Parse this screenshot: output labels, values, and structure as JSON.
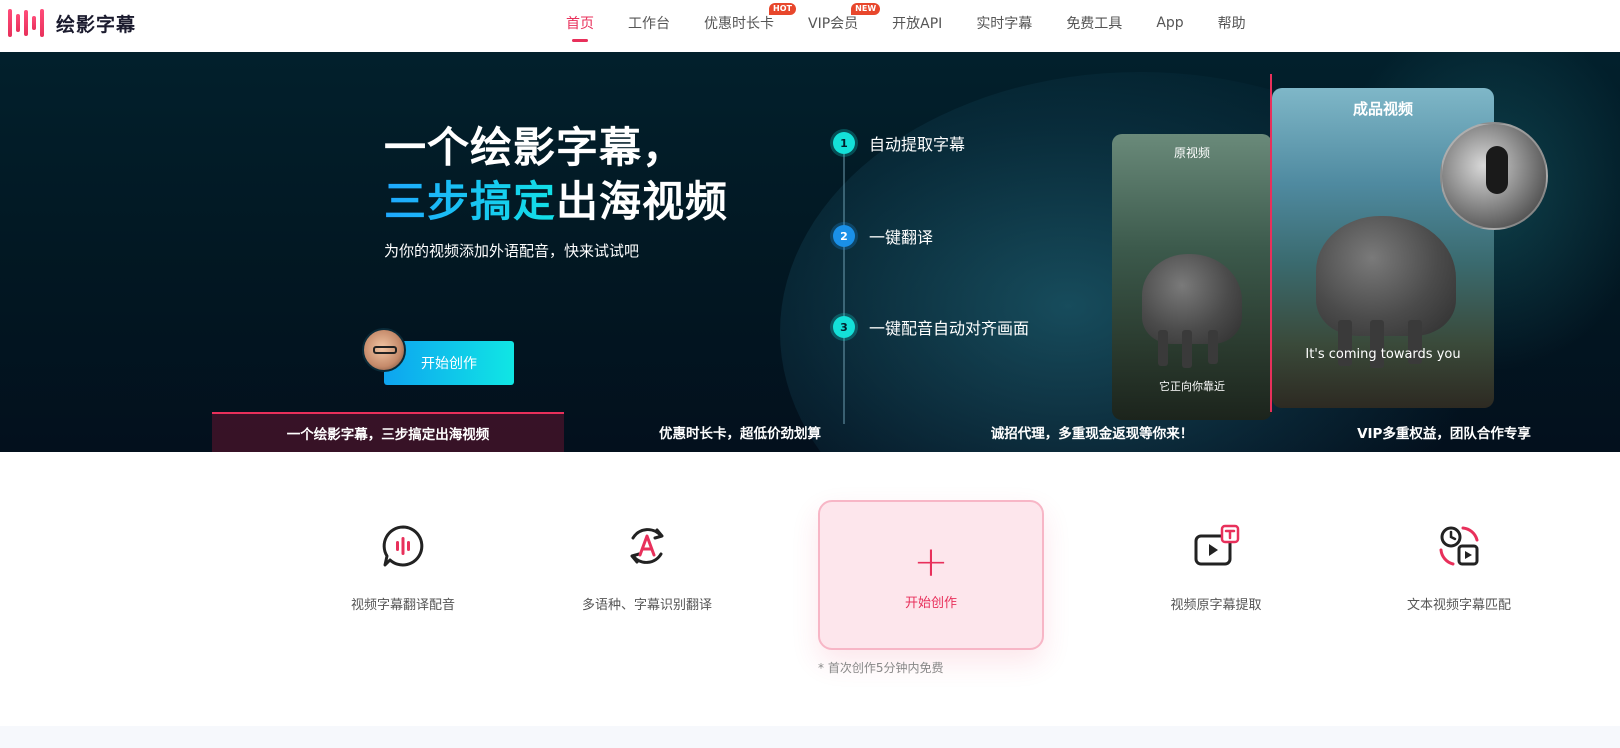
{
  "brand": {
    "name": "绘影字幕",
    "logo_icon": "waveform-logo-icon",
    "accent": "#e8305b"
  },
  "nav": {
    "items": [
      {
        "label": "首页",
        "active": true
      },
      {
        "label": "工作台"
      },
      {
        "label": "优惠时长卡",
        "badge": "HOT"
      },
      {
        "label": "VIP会员",
        "badge": "NEW"
      },
      {
        "label": "开放API"
      },
      {
        "label": "实时字幕"
      },
      {
        "label": "免费工具"
      },
      {
        "label": "App"
      },
      {
        "label": "帮助"
      }
    ]
  },
  "hero": {
    "title_line1": "一个绘影字幕，",
    "title_line2_highlight": "三步搞定",
    "title_line2_rest": "出海视频",
    "subtitle": "为你的视频添加外语配音，快来试试吧",
    "cta": "开始创作",
    "steps": [
      {
        "num": "1",
        "label": "自动提取字幕"
      },
      {
        "num": "2",
        "label": "一键翻译"
      },
      {
        "num": "3",
        "label": "一键配音自动对齐画面"
      }
    ],
    "original_card": {
      "title": "原视频",
      "caption": "它正向你靠近"
    },
    "final_card": {
      "title": "成品视频",
      "caption": "It's coming towards you"
    }
  },
  "banner_strip": [
    {
      "label": "一个绘影字幕，三步搞定出海视频",
      "active": true
    },
    {
      "label": "优惠时长卡，超低价劲划算"
    },
    {
      "label": "诚招代理，多重现金返现等你来！"
    },
    {
      "label": "VIP多重权益，团队合作专享"
    }
  ],
  "features": [
    {
      "label": "视频字幕翻译配音",
      "icon": "speech-bubble-waveform-icon"
    },
    {
      "label": "多语种、字幕识别翻译",
      "icon": "letter-a-rotate-icon"
    },
    {
      "label": "视频原字幕提取",
      "icon": "video-text-icon"
    },
    {
      "label": "文本视频字幕匹配",
      "icon": "clock-video-sync-icon"
    }
  ],
  "create": {
    "label": "开始创作",
    "note": "* 首次创作5分钟内免费"
  }
}
